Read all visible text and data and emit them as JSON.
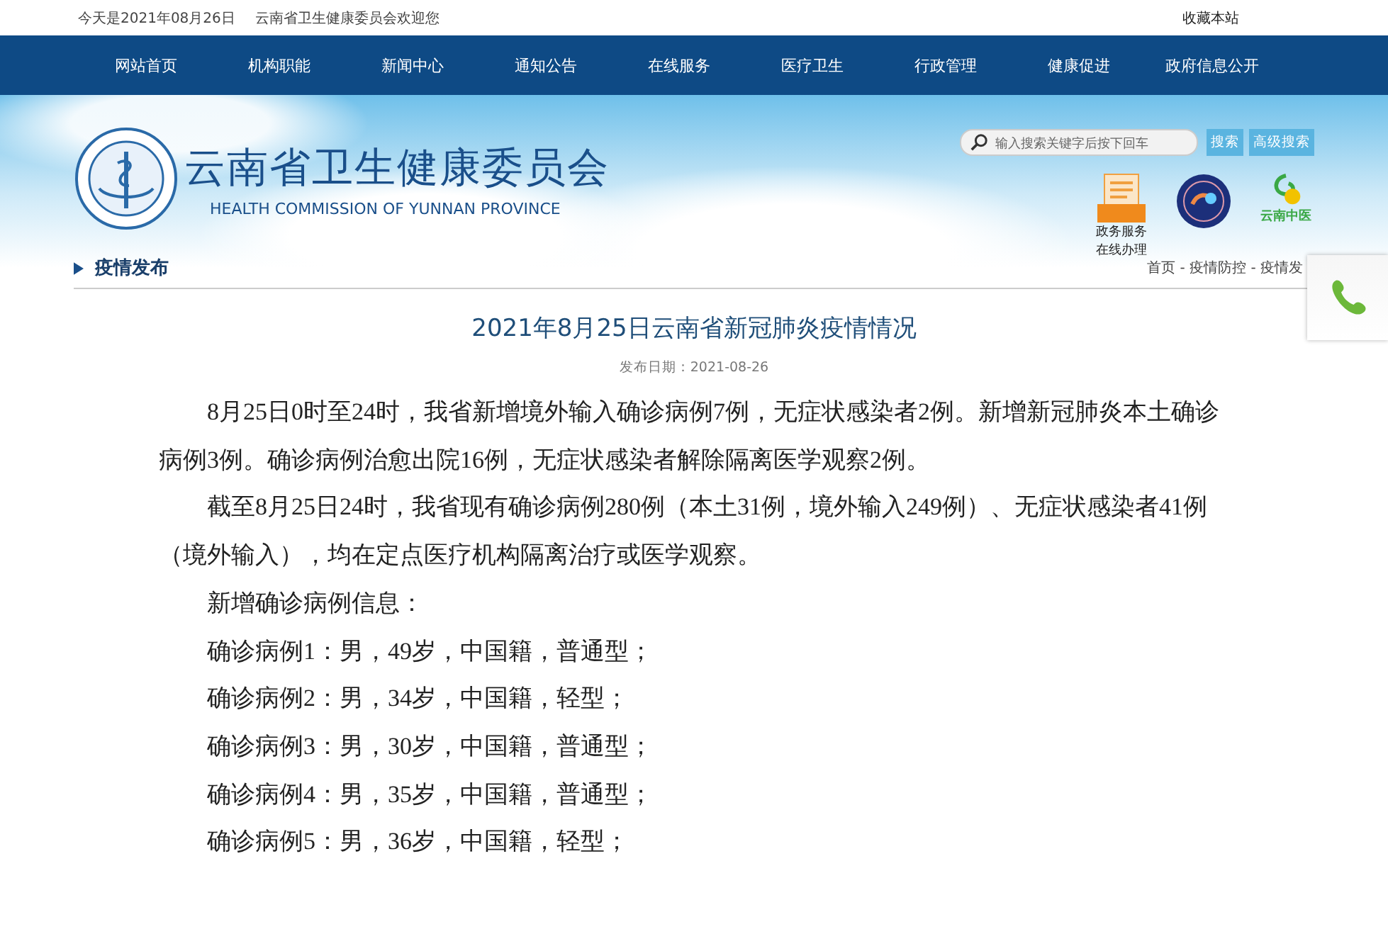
{
  "top_bar": {
    "date": "今天是2021年08月26日",
    "welcome": "云南省卫生健康委员会欢迎您",
    "bookmark": "收藏本站"
  },
  "nav": [
    {
      "label": "网站首页",
      "selected": false
    },
    {
      "label": "机构职能",
      "selected": false
    },
    {
      "label": "新闻中心",
      "selected": false
    },
    {
      "label": "通知公告",
      "selected": false
    },
    {
      "label": "在线服务",
      "selected": false
    },
    {
      "label": "医疗卫生",
      "selected": false
    },
    {
      "label": "行政管理",
      "selected": false
    },
    {
      "label": "健康促进",
      "selected": false
    },
    {
      "label": "政府信息公开",
      "selected": false
    }
  ],
  "header": {
    "title": "云南省卫生健康委员会",
    "subtitle": "HEALTH COMMISSION OF YUNNAN PROVINCE",
    "search": {
      "placeholder": "输入搜索关键字后按下回车"
    },
    "buttons": [
      "搜索",
      "高级搜索"
    ],
    "service": [
      "政务服务",
      "在线办理"
    ],
    "tcm_logo": "云南中医"
  },
  "section": {
    "title": "疫情发布",
    "breadcrumb": "首页 - 疫情防控 - 疫情发"
  },
  "article": {
    "title": "2021年8月25日云南省新冠肺炎疫情情况",
    "date": "发布日期：2021-08-26",
    "paragraphs": [
      "8月25日0时至24时，我省新增境外输入确诊病例7例，无症状感染者2例。新增新冠肺炎本土确诊病例3例。确诊病例治愈出院16例，无症状感染者解除隔离医学观察2例。",
      "截至8月25日24时，我省现有确诊病例280例（本土31例，境外输入249例）、无症状感染者41例（境外输入），均在定点医疗机构隔离治疗或医学观察。",
      "新增确诊病例信息：",
      "确诊病例1：男，49岁，中国籍，普通型；",
      "确诊病例2：男，34岁，中国籍，轻型；",
      "确诊病例3：男，30岁，中国籍，普通型；",
      "确诊病例4：男，35岁，中国籍，普通型；",
      "确诊病例5：男，36岁，中国籍，轻型；"
    ]
  }
}
